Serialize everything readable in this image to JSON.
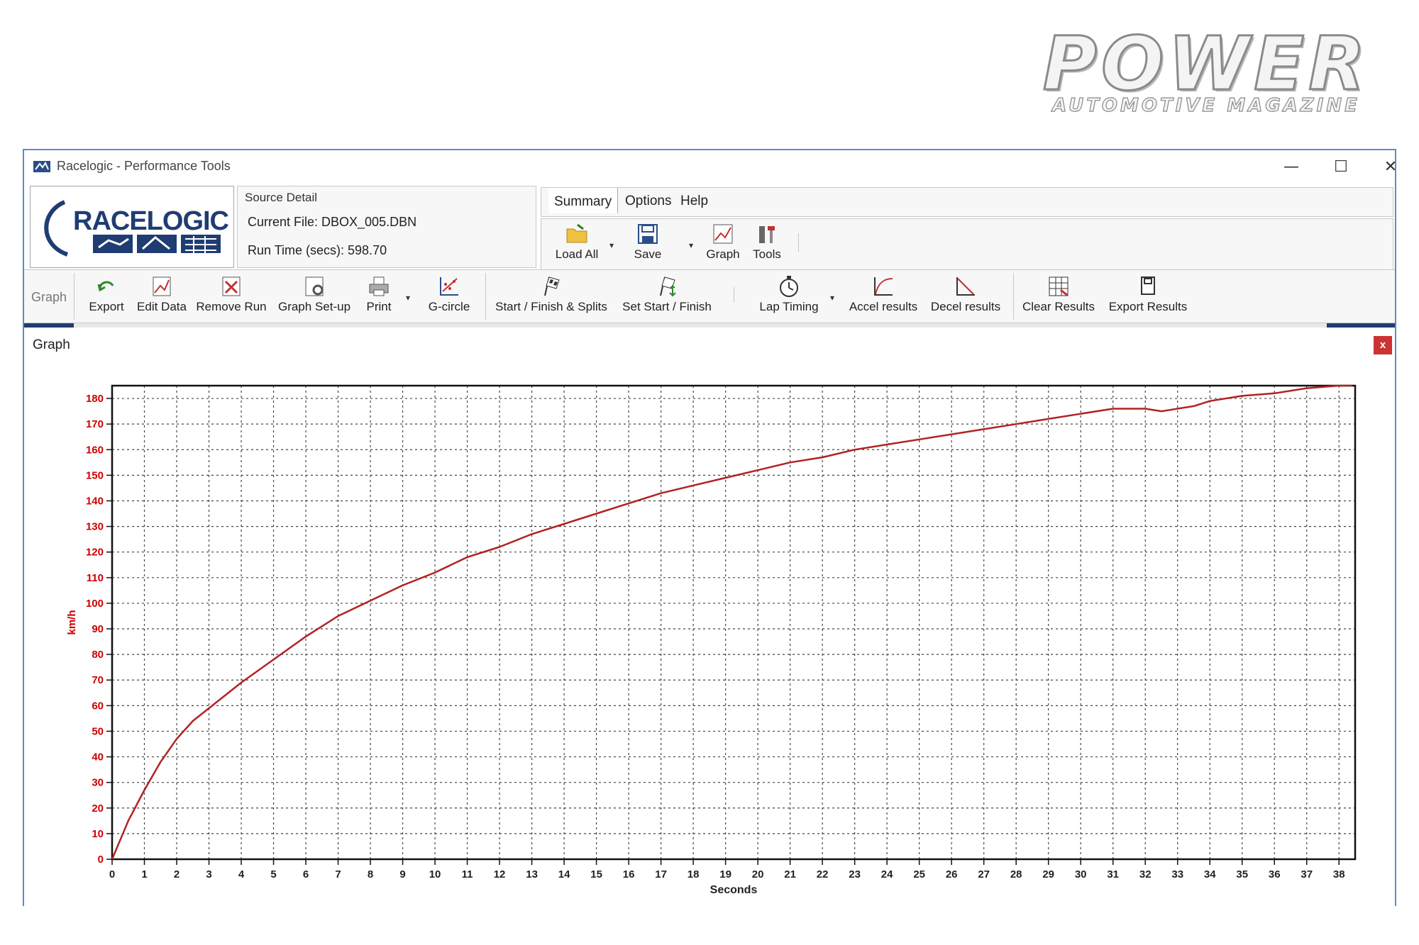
{
  "magazine": {
    "title": "POWER",
    "subtitle": "AUTOMOTIVE MAGAZINE"
  },
  "window": {
    "title": "Racelogic - Performance Tools",
    "controls": {
      "minimize": "—",
      "maximize": "☐",
      "close": "✕"
    }
  },
  "logo": {
    "text": "RACELOGIC"
  },
  "source": {
    "title": "Source Detail",
    "current_file": "Current File: DBOX_005.DBN",
    "run_time": "Run Time (secs): 598.70"
  },
  "menu": {
    "summary": "Summary",
    "options": "Options",
    "help": "Help"
  },
  "top_toolbar": {
    "load_all": "Load All",
    "save": "Save",
    "graph": "Graph",
    "tools": "Tools"
  },
  "main_toolbar": {
    "group_label": "Graph",
    "export": "Export",
    "edit_data": "Edit Data",
    "remove_run": "Remove Run",
    "graph_setup": "Graph Set-up",
    "print": "Print",
    "g_circle": "G-circle",
    "start_finish_splits": "Start / Finish & Splits",
    "set_start_finish": "Set Start / Finish",
    "lap_timing": "Lap Timing",
    "accel_results": "Accel results",
    "decel_results": "Decel results",
    "clear_results": "Clear Results",
    "export_results": "Export Results"
  },
  "graph_panel": {
    "label": "Graph",
    "close": "x"
  },
  "colors": {
    "accent": "#1f3c73",
    "series": "#b22222",
    "axis_text": "#cc0000"
  },
  "chart_data": {
    "type": "line",
    "xlabel": "Seconds",
    "ylabel": "km/h",
    "xlim": [
      0,
      38.5
    ],
    "ylim": [
      0,
      185
    ],
    "x_ticks": [
      0,
      1,
      2,
      3,
      4,
      5,
      6,
      7,
      8,
      9,
      10,
      11,
      12,
      13,
      14,
      15,
      16,
      17,
      18,
      19,
      20,
      21,
      22,
      23,
      24,
      25,
      26,
      27,
      28,
      29,
      30,
      31,
      32,
      33,
      34,
      35,
      36,
      37,
      38
    ],
    "y_ticks": [
      0,
      10,
      20,
      30,
      40,
      50,
      60,
      70,
      80,
      90,
      100,
      110,
      120,
      130,
      140,
      150,
      160,
      170,
      180
    ],
    "grid": true,
    "series": [
      {
        "x": [
          0,
          0.5,
          1,
          1.5,
          2,
          2.5,
          3,
          3.5,
          4,
          5,
          6,
          7,
          8,
          9,
          10,
          11,
          12,
          13,
          14,
          15,
          16,
          17,
          18,
          19,
          20,
          21,
          22,
          23,
          24,
          25,
          26,
          27,
          28,
          29,
          30,
          31,
          31.5,
          32,
          32.5,
          33,
          33.5,
          34,
          35,
          36,
          37,
          38,
          38.4
        ],
        "y": [
          0,
          15,
          27,
          38,
          47,
          54,
          59,
          64,
          69,
          78,
          87,
          95,
          101,
          107,
          112,
          118,
          122,
          127,
          131,
          135,
          139,
          143,
          146,
          149,
          152,
          155,
          157,
          160,
          162,
          164,
          166,
          168,
          170,
          172,
          174,
          176,
          176,
          176,
          175,
          176,
          177,
          179,
          181,
          182,
          184,
          185,
          185
        ]
      }
    ]
  }
}
